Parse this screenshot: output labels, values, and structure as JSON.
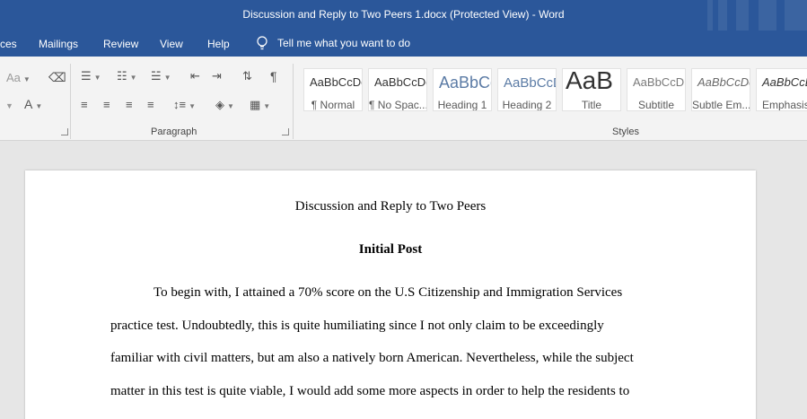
{
  "window": {
    "title": "Discussion and Reply to Two Peers 1.docx (Protected View)  -  Word"
  },
  "tabs": [
    {
      "label": "ces"
    },
    {
      "label": "Mailings"
    },
    {
      "label": "Review"
    },
    {
      "label": "View"
    },
    {
      "label": "Help"
    }
  ],
  "tellme": {
    "label": "Tell me what you want to do"
  },
  "ribbon": {
    "font_group": {
      "change_case": "Aa",
      "font_color": "A"
    },
    "paragraph_group": {
      "label": "Paragraph",
      "pilcrow": "¶"
    },
    "styles_group": {
      "label": "Styles",
      "items": [
        {
          "preview": "AaBbCcDc",
          "name": "¶ Normal"
        },
        {
          "preview": "AaBbCcDc",
          "name": "¶ No Spac..."
        },
        {
          "preview": "AaBbCc",
          "name": "Heading 1"
        },
        {
          "preview": "AaBbCcD",
          "name": "Heading 2"
        },
        {
          "preview": "AaB",
          "name": "Title"
        },
        {
          "preview": "AaBbCcD",
          "name": "Subtitle"
        },
        {
          "preview": "AaBbCcDc",
          "name": "Subtle Em..."
        },
        {
          "preview": "AaBbCcDc",
          "name": "Emphasis"
        }
      ]
    }
  },
  "document": {
    "title": "Discussion and Reply to Two Peers",
    "heading": "Initial Post",
    "lines": [
      "To begin with, I attained a 70% score on the U.S Citizenship and Immigration Services",
      "practice test. Undoubtedly, this is quite humiliating since I not only claim to be exceedingly",
      "familiar with civil matters, but am also a natively born American. Nevertheless, while the subject",
      "matter in this test is quite viable, I would add some more aspects in order to help the residents to"
    ]
  },
  "colors": {
    "accent": "#2b579a"
  }
}
